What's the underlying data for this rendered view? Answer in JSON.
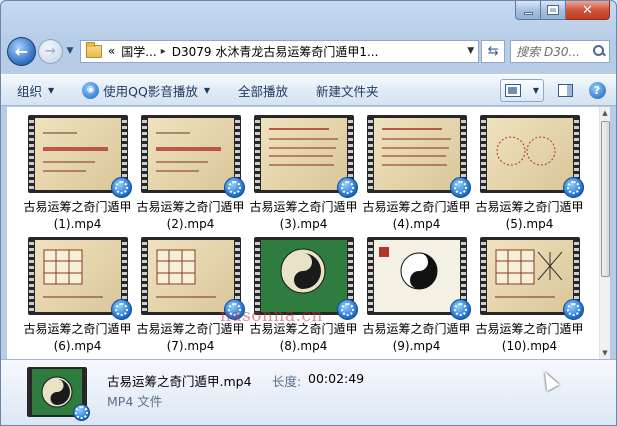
{
  "window": {
    "caption_buttons": [
      "minimize",
      "maximize",
      "close"
    ],
    "close_glyph": "✕"
  },
  "nav": {
    "back_icon": "arrow-left-icon",
    "forward_icon": "arrow-right-icon",
    "breadcrumb": [
      "国学...",
      "D3079 水沐青龙古易运筹奇门遁甲1..."
    ],
    "breadcrumb_prefix": "«",
    "separator": "▸",
    "search_placeholder": "搜索 D30..."
  },
  "toolbar": {
    "organize": "组织",
    "play_with": "使用QQ影音播放",
    "play_all": "全部播放",
    "new_folder": "新建文件夹"
  },
  "files": [
    {
      "name": "古易运筹之奇门遁甲(1).mp4",
      "theme": "title-red"
    },
    {
      "name": "古易运筹之奇门遁甲(2).mp4",
      "theme": "title-red"
    },
    {
      "name": "古易运筹之奇门遁甲(3).mp4",
      "theme": "text"
    },
    {
      "name": "古易运筹之奇门遁甲(4).mp4",
      "theme": "text"
    },
    {
      "name": "古易运筹之奇门遁甲(5).mp4",
      "theme": "circles"
    },
    {
      "name": "古易运筹之奇门遁甲(6).mp4",
      "theme": "grid"
    },
    {
      "name": "古易运筹之奇门遁甲(7).mp4",
      "theme": "grid"
    },
    {
      "name": "古易运筹之奇门遁甲(8).mp4",
      "theme": "bagua-green"
    },
    {
      "name": "古易运筹之奇门遁甲(9).mp4",
      "theme": "yinyang"
    },
    {
      "name": "古易运筹之奇门遁甲(10).mp4",
      "theme": "grid-lines"
    }
  ],
  "details": {
    "name": "古易运筹之奇门遁甲.mp4",
    "length_label": "长度:",
    "length": "00:02:49",
    "type": "MP4 文件"
  },
  "watermark": "nasonna.cn",
  "colors": {
    "accent": "#1967c9",
    "close": "#c23b22",
    "thumb_bg": "#e4d3a8",
    "thumb_green": "#2e7d3f"
  }
}
